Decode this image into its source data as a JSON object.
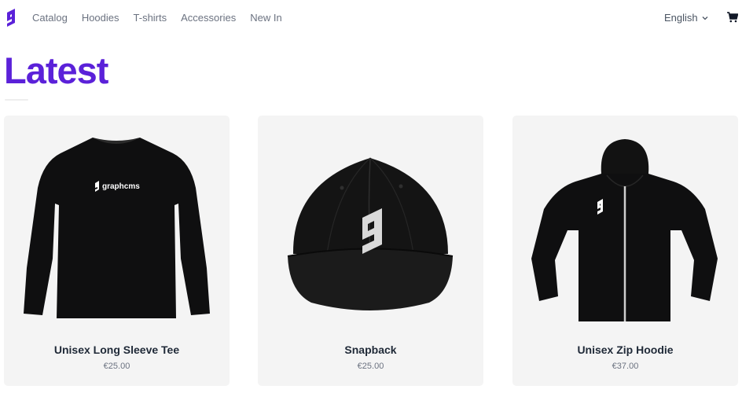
{
  "nav": {
    "logo_icon": "graphcms-logo-icon",
    "links": [
      "Catalog",
      "Hoodies",
      "T-shirts",
      "Accessories",
      "New In"
    ],
    "language": "English",
    "cart_icon": "cart-icon"
  },
  "page": {
    "title": "Latest"
  },
  "colors": {
    "brand": "#5b21d9",
    "card_bg": "#f4f4f4"
  },
  "products": [
    {
      "name": "Unisex Long Sleeve Tee",
      "price": "€25.00",
      "image": "long-sleeve-tee-image",
      "print": "graphcms"
    },
    {
      "name": "Snapback",
      "price": "€25.00",
      "image": "snapback-cap-image"
    },
    {
      "name": "Unisex Zip Hoodie",
      "price": "€37.00",
      "image": "zip-hoodie-image"
    }
  ]
}
